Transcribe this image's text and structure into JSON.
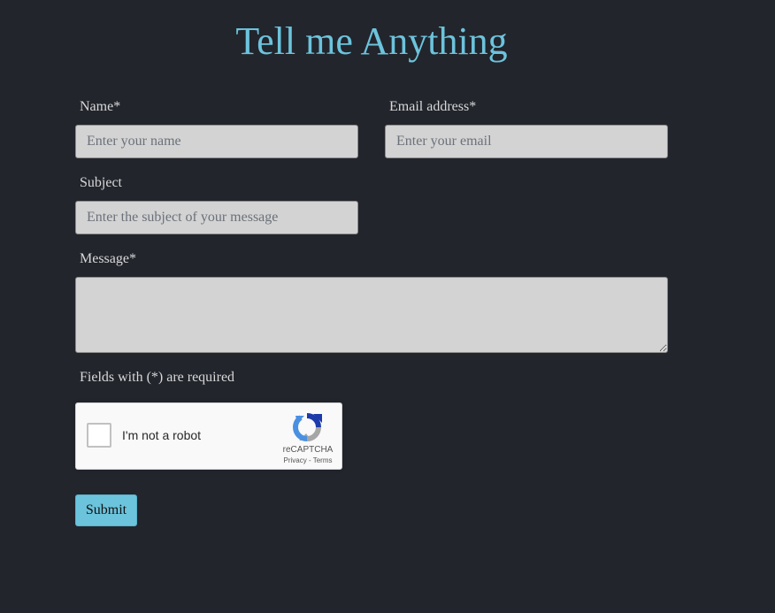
{
  "page": {
    "title": "Tell me Anything"
  },
  "form": {
    "name": {
      "label": "Name*",
      "placeholder": "Enter your name",
      "value": ""
    },
    "email": {
      "label": "Email address*",
      "placeholder": "Enter your email",
      "value": ""
    },
    "subject": {
      "label": "Subject",
      "placeholder": "Enter the subject of your message",
      "value": ""
    },
    "message": {
      "label": "Message*",
      "placeholder": "",
      "value": ""
    },
    "required_note": "Fields with (*) are required",
    "submit_label": "Submit"
  },
  "captcha": {
    "label": "I'm not a robot",
    "brand": "reCAPTCHA",
    "privacy": "Privacy",
    "separator": " - ",
    "terms": "Terms",
    "checked": false,
    "icon": "recaptcha-logo-icon"
  },
  "colors": {
    "background": "#22252c",
    "accent": "#6cc3dc",
    "input_bg": "#d3d3d3",
    "label_text": "#d8d8d8"
  }
}
